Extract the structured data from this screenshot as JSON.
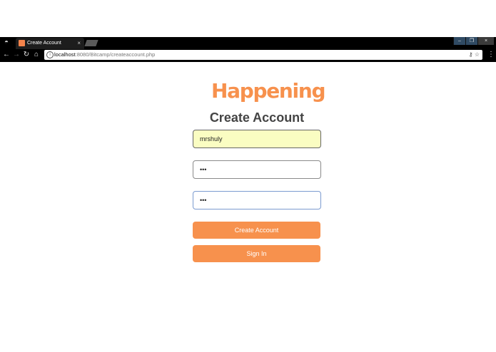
{
  "browser": {
    "tab_title": "Create Account",
    "tab_close": "×",
    "url_host": "localhost",
    "url_rest": ":8080/Bitcamp/createaccount.php",
    "window_buttons": [
      "–",
      "❐",
      "×"
    ]
  },
  "page": {
    "logo": "Happening",
    "title": "Create Account",
    "username_value": "mrshuly",
    "password_value": "•••",
    "confirm_password_value": "•••",
    "create_button": "Create Account",
    "signin_button": "Sign In"
  },
  "colors": {
    "accent": "#f7914d",
    "username_autofill_bg": "#fafdc2",
    "chrome_bg": "#000000"
  }
}
